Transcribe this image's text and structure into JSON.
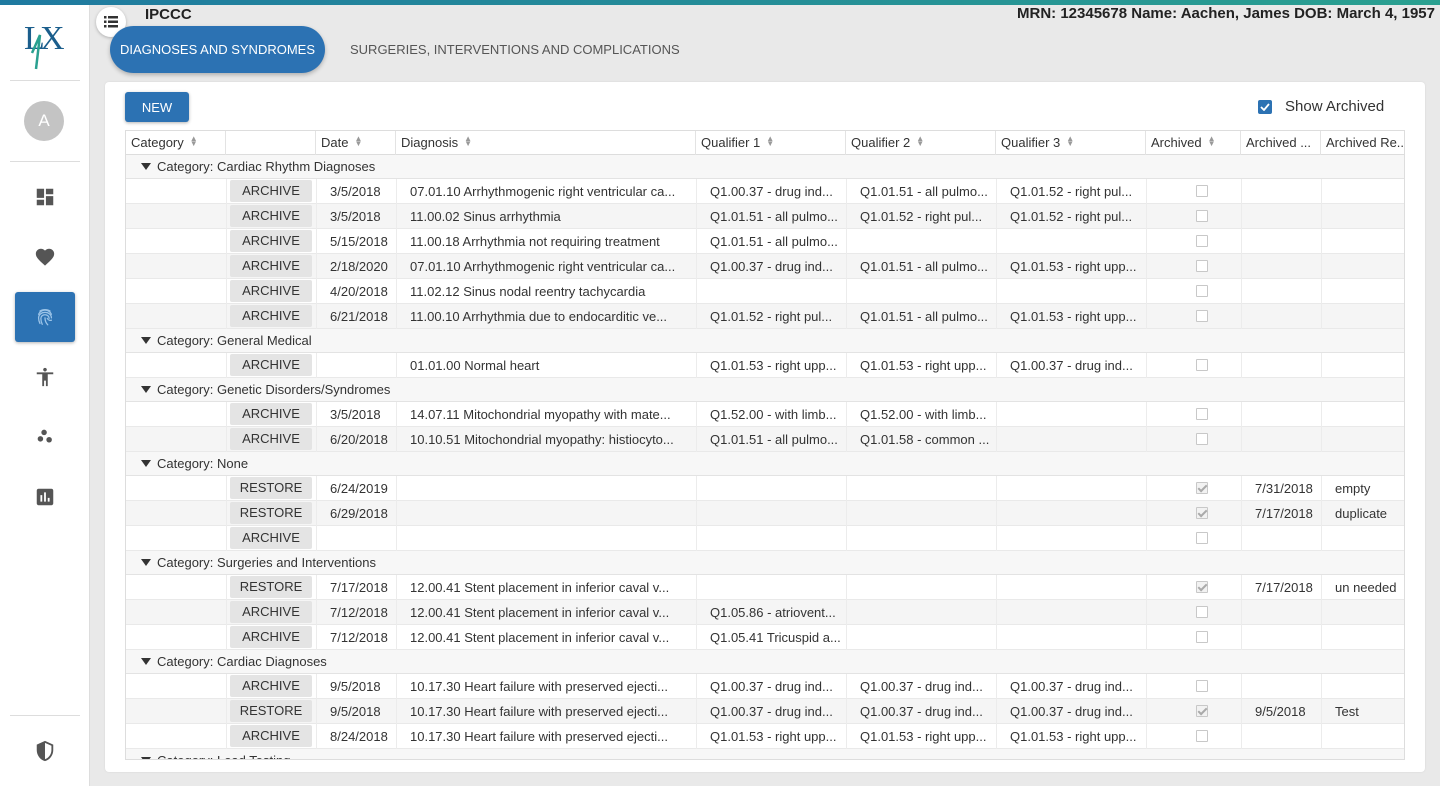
{
  "app": {
    "title": "IPCCC",
    "patient_info": "MRN: 12345678 Name: Aachen, James DOB: March 4, 1957",
    "avatar_initial": "A",
    "accent": "#2c72b3"
  },
  "tabs": [
    {
      "label": "DIAGNOSES AND SYNDROMES",
      "active": true
    },
    {
      "label": "SURGERIES, INTERVENTIONS AND COMPLICATIONS",
      "active": false
    }
  ],
  "sidebar": {
    "items": [
      {
        "icon": "dashboard-icon"
      },
      {
        "icon": "heart-icon"
      },
      {
        "icon": "fingerprint-icon",
        "active": true
      },
      {
        "icon": "accessibility-icon"
      },
      {
        "icon": "scatter-icon"
      },
      {
        "icon": "bar-chart-icon"
      }
    ],
    "bottom_icon": "shield-icon"
  },
  "toolbar": {
    "new_label": "NEW",
    "show_archived_label": "Show Archived",
    "show_archived_checked": true
  },
  "columns": [
    "Category",
    "",
    "Date",
    "Diagnosis",
    "Qualifier 1",
    "Qualifier 2",
    "Qualifier 3",
    "Archived",
    "Archived ...",
    "Archived Re..."
  ],
  "groups": [
    {
      "label": "Category: Cardiac Rhythm Diagnoses",
      "rows": [
        {
          "action": "ARCHIVE",
          "date": "3/5/2018",
          "diagnosis": "07.01.10 Arrhythmogenic right ventricular ca...",
          "q1": "Q1.00.37 - drug ind...",
          "q2": "Q1.01.51 - all pulmo...",
          "q3": "Q1.01.52 - right pul...",
          "archived": false,
          "archived_date": "",
          "archived_reason": ""
        },
        {
          "action": "ARCHIVE",
          "date": "3/5/2018",
          "diagnosis": "11.00.02 Sinus arrhythmia",
          "q1": "Q1.01.51 - all pulmo...",
          "q2": "Q1.01.52 - right pul...",
          "q3": "Q1.01.52 - right pul...",
          "archived": false,
          "archived_date": "",
          "archived_reason": ""
        },
        {
          "action": "ARCHIVE",
          "date": "5/15/2018",
          "diagnosis": "11.00.18 Arrhythmia not requiring treatment",
          "q1": "Q1.01.51 - all pulmo...",
          "q2": "",
          "q3": "",
          "archived": false,
          "archived_date": "",
          "archived_reason": ""
        },
        {
          "action": "ARCHIVE",
          "date": "2/18/2020",
          "diagnosis": "07.01.10 Arrhythmogenic right ventricular ca...",
          "q1": "Q1.00.37 - drug ind...",
          "q2": "Q1.01.51 - all pulmo...",
          "q3": "Q1.01.53 - right upp...",
          "archived": false,
          "archived_date": "",
          "archived_reason": ""
        },
        {
          "action": "ARCHIVE",
          "date": "4/20/2018",
          "diagnosis": "11.02.12 Sinus nodal reentry tachycardia",
          "q1": "",
          "q2": "",
          "q3": "",
          "archived": false,
          "archived_date": "",
          "archived_reason": ""
        },
        {
          "action": "ARCHIVE",
          "date": "6/21/2018",
          "diagnosis": "11.00.10 Arrhythmia due to endocarditic ve...",
          "q1": "Q1.01.52 - right pul...",
          "q2": "Q1.01.51 - all pulmo...",
          "q3": "Q1.01.53 - right upp...",
          "archived": false,
          "archived_date": "",
          "archived_reason": ""
        }
      ]
    },
    {
      "label": "Category: General Medical",
      "rows": [
        {
          "action": "ARCHIVE",
          "date": "",
          "diagnosis": "01.01.00 Normal heart",
          "q1": "Q1.01.53 - right upp...",
          "q2": "Q1.01.53 - right upp...",
          "q3": "Q1.00.37 - drug ind...",
          "archived": false,
          "archived_date": "",
          "archived_reason": ""
        }
      ]
    },
    {
      "label": "Category: Genetic Disorders/Syndromes",
      "rows": [
        {
          "action": "ARCHIVE",
          "date": "3/5/2018",
          "diagnosis": "14.07.11 Mitochondrial myopathy with mate...",
          "q1": "Q1.52.00 - with limb...",
          "q2": "Q1.52.00 - with limb...",
          "q3": "",
          "archived": false,
          "archived_date": "",
          "archived_reason": ""
        },
        {
          "action": "ARCHIVE",
          "date": "6/20/2018",
          "diagnosis": "10.10.51 Mitochondrial myopathy: histiocyto...",
          "q1": "Q1.01.51 - all pulmo...",
          "q2": "Q1.01.58 - common ...",
          "q3": "",
          "archived": false,
          "archived_date": "",
          "archived_reason": ""
        }
      ]
    },
    {
      "label": "Category: None",
      "rows": [
        {
          "action": "RESTORE",
          "date": "6/24/2019",
          "diagnosis": "",
          "q1": "",
          "q2": "",
          "q3": "",
          "archived": true,
          "archived_date": "7/31/2018",
          "archived_reason": "empty"
        },
        {
          "action": "RESTORE",
          "date": "6/29/2018",
          "diagnosis": "",
          "q1": "",
          "q2": "",
          "q3": "",
          "archived": true,
          "archived_date": "7/17/2018",
          "archived_reason": "duplicate"
        },
        {
          "action": "ARCHIVE",
          "date": "",
          "diagnosis": "",
          "q1": "",
          "q2": "",
          "q3": "",
          "archived": false,
          "archived_date": "",
          "archived_reason": ""
        }
      ]
    },
    {
      "label": "Category: Surgeries and Interventions",
      "rows": [
        {
          "action": "RESTORE",
          "date": "7/17/2018",
          "diagnosis": "12.00.41 Stent placement in inferior caval v...",
          "q1": "",
          "q2": "",
          "q3": "",
          "archived": true,
          "archived_date": "7/17/2018",
          "archived_reason": "un needed"
        },
        {
          "action": "ARCHIVE",
          "date": "7/12/2018",
          "diagnosis": "12.00.41 Stent placement in inferior caval v...",
          "q1": "Q1.05.86 - atriovent...",
          "q2": "",
          "q3": "",
          "archived": false,
          "archived_date": "",
          "archived_reason": ""
        },
        {
          "action": "ARCHIVE",
          "date": "7/12/2018",
          "diagnosis": "12.00.41 Stent placement in inferior caval v...",
          "q1": "Q1.05.41 Tricuspid a...",
          "q2": "",
          "q3": "",
          "archived": false,
          "archived_date": "",
          "archived_reason": ""
        }
      ]
    },
    {
      "label": "Category: Cardiac Diagnoses",
      "rows": [
        {
          "action": "ARCHIVE",
          "date": "9/5/2018",
          "diagnosis": "10.17.30 Heart failure with preserved ejecti...",
          "q1": "Q1.00.37 - drug ind...",
          "q2": "Q1.00.37 - drug ind...",
          "q3": "Q1.00.37 - drug ind...",
          "archived": false,
          "archived_date": "",
          "archived_reason": ""
        },
        {
          "action": "RESTORE",
          "date": "9/5/2018",
          "diagnosis": "10.17.30 Heart failure with preserved ejecti...",
          "q1": "Q1.00.37 - drug ind...",
          "q2": "Q1.00.37 - drug ind...",
          "q3": "Q1.00.37 - drug ind...",
          "archived": true,
          "archived_date": "9/5/2018",
          "archived_reason": "Test"
        },
        {
          "action": "ARCHIVE",
          "date": "8/24/2018",
          "diagnosis": "10.17.30 Heart failure with preserved ejecti...",
          "q1": "Q1.01.53 - right upp...",
          "q2": "Q1.01.53 - right upp...",
          "q3": "Q1.01.53 - right upp...",
          "archived": false,
          "archived_date": "",
          "archived_reason": ""
        }
      ]
    },
    {
      "label": "Category: Load Testing",
      "rows": []
    }
  ]
}
